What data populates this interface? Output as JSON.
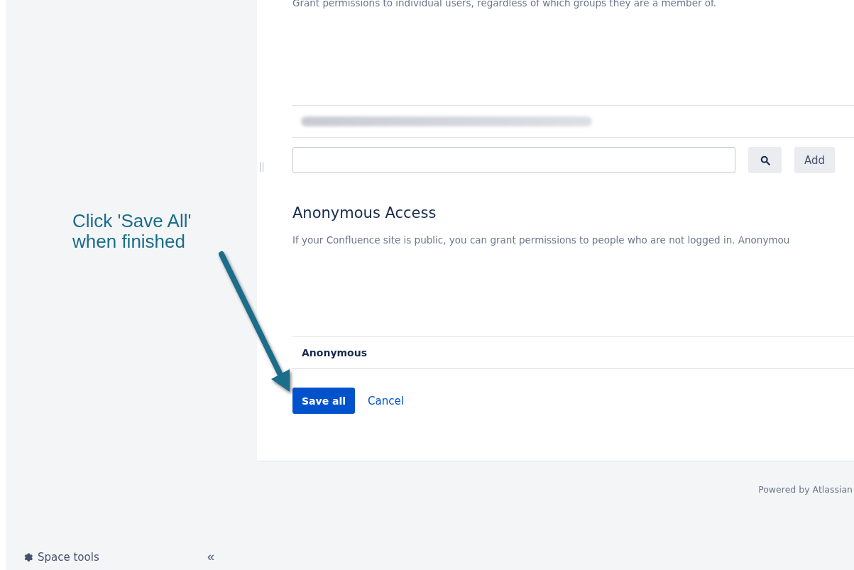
{
  "individual_permissions": {
    "description": "Grant permissions to individual users, regardless of which groups they are a member of.",
    "add_button": "Add"
  },
  "anonymous_access": {
    "heading": "Anonymous Access",
    "description": "If your Confluence site is public, you can grant permissions to people who are not logged in. Anonymou",
    "row_label": "Anonymous"
  },
  "actions": {
    "save": "Save all",
    "cancel": "Cancel"
  },
  "annotation": {
    "text": "Click 'Save All'\nwhen finished"
  },
  "footer": {
    "text": "Powered by Atlassian"
  },
  "sidebar": {
    "space_tools": "Space tools",
    "collapse": "«"
  }
}
